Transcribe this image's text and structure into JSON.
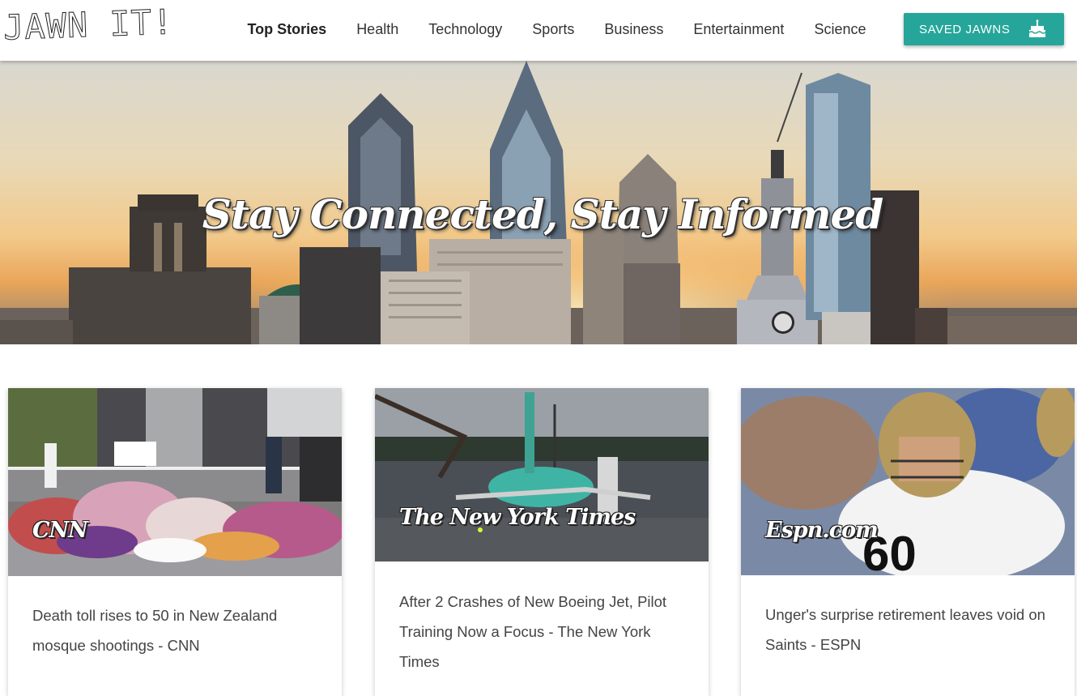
{
  "nav": {
    "logo": "JAWN IT!",
    "links": [
      "Top Stories",
      "Health",
      "Technology",
      "Sports",
      "Business",
      "Entertainment",
      "Science"
    ],
    "saved_label": "SAVED JAWNS",
    "saved_icon": "cake-icon"
  },
  "hero": {
    "title": "Stay Connected, Stay Informed"
  },
  "cards": [
    {
      "source": "CNN",
      "headline": "Death toll rises to 50 in New Zealand mosque shootings - CNN"
    },
    {
      "source": "The New York Times",
      "headline": "After 2 Crashes of New Boeing Jet, Pilot Training Now a Focus - The New York Times"
    },
    {
      "source": "Espn.com",
      "headline": "Unger's surprise retirement leaves void on Saints - ESPN"
    }
  ],
  "colors": {
    "accent": "#26a69a"
  }
}
